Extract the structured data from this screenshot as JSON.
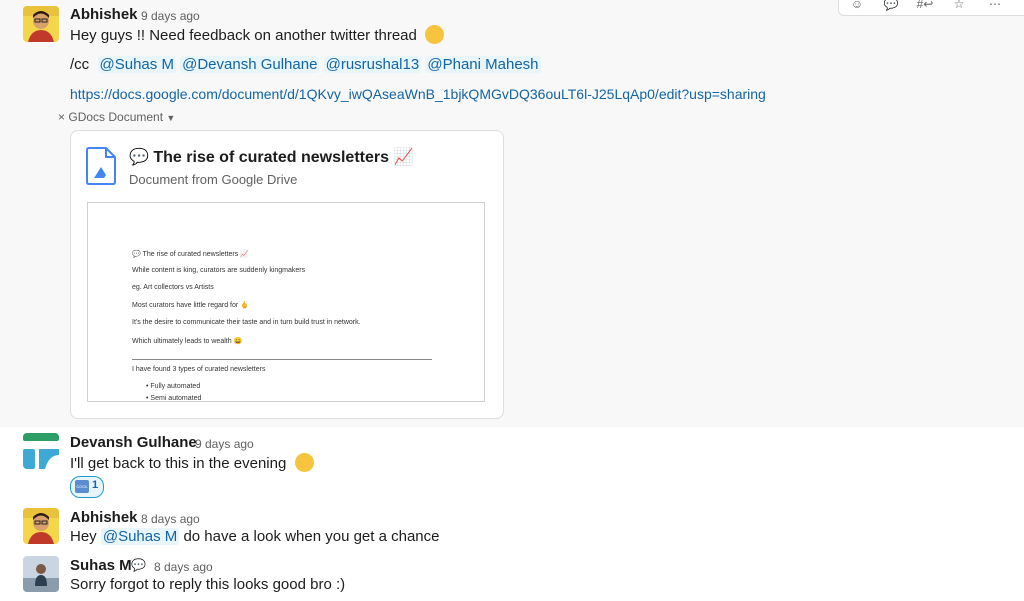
{
  "toolbar": {
    "icons": [
      "emoji-icon",
      "reply-thread-icon",
      "share-channel-icon",
      "bookmark-icon",
      "more-actions-icon"
    ],
    "labels": [
      "☺",
      "💬",
      "#↩",
      "☆",
      "⋯"
    ]
  },
  "messages": [
    {
      "author": "Abhishek",
      "time": "9 days ago",
      "text": "Hey guys !! Need feedback on another twitter thread",
      "cc_prefix": "/cc",
      "mentions": [
        "@Suhas M",
        "@Devansh Gulhane",
        "@rusrushal13",
        "@Phani Mahesh"
      ],
      "link": "https://docs.google.com/document/d/1QKvy_iwQAseaWnB_1bjkQMGvDQ36ouLT6l-J25LqAp0/edit?usp=sharing",
      "attachment": {
        "remove_icon": "×",
        "label": "GDocs Document",
        "card_title": "The rise of curated newsletters",
        "card_subtitle": "Document from Google Drive",
        "preview": {
          "title": "The rise of curated newsletters",
          "lines": [
            "While content is king, curators are suddenly kingmakers",
            "eg. Art collectors vs Artists",
            "Most curators have little regard for",
            "It's the desire to communicate their taste and in turn build trust in network.",
            "Which ultimately leads to wealth",
            "I have found 3 types of curated newsletters"
          ],
          "bullets": [
            "Fully automated",
            "Semi automated"
          ]
        }
      }
    },
    {
      "author": "Devansh Gulhane",
      "time": "9 days ago",
      "text": "I'll get back to this in the evening",
      "reaction": {
        "emoji_label": "COOL",
        "count": "1"
      }
    },
    {
      "author": "Abhishek",
      "time": "8 days ago",
      "text_before": "Hey",
      "mention": "@Suhas M",
      "text_after": "do have a look when you get a chance"
    },
    {
      "author": "Suhas M",
      "status_icon": "speech-bubble-icon",
      "time": "8 days ago",
      "text": "Sorry forgot to reply this looks good bro :)"
    }
  ],
  "colors": {
    "link": "#1264a3",
    "mention_bg": "#e8f5fa",
    "hover_bg": "#f8f8f8",
    "gdocs_blue": "#4285f4"
  }
}
